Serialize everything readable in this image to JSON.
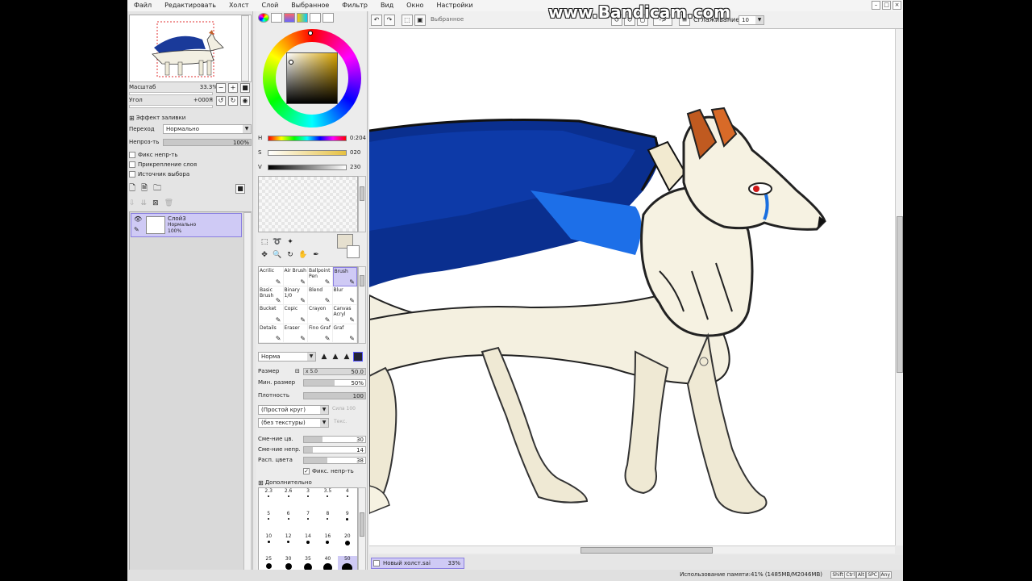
{
  "menu": [
    "Файл",
    "Редактировать",
    "Холст",
    "Слой",
    "Выбранное",
    "Фильтр",
    "Вид",
    "Окно",
    "Настройки"
  ],
  "watermark": "www.Bandicam.com",
  "navigator": {
    "zoom_label": "Масштаб",
    "zoom_value": "33.3%",
    "angle_label": "Угол",
    "angle_value": "+000Я"
  },
  "layer_panel": {
    "fill_effect": "Эффект заливки",
    "blend_label": "Переход",
    "blend_value": "Нормально",
    "opacity_label": "Непроз-ть",
    "opacity_value": "100%",
    "opacity_fraction": 1.0,
    "checkboxes": [
      "Фикс непр-ть",
      "Прикрепление слоя",
      "Источник выбора"
    ],
    "layers": [
      {
        "name": "Слой3",
        "mode": "Нормально",
        "opacity": "100%"
      }
    ]
  },
  "color": {
    "h_label": "H",
    "h_value": "0:204",
    "s_label": "S",
    "s_value": "020",
    "v_label": "V",
    "v_value": "230"
  },
  "brushes": [
    {
      "name": "Acrilic"
    },
    {
      "name": "Air Brush"
    },
    {
      "name": "Ballpoint Pen"
    },
    {
      "name": "Brush"
    },
    {
      "name": "Basic Brush"
    },
    {
      "name": "Binary 1/0"
    },
    {
      "name": "Blend"
    },
    {
      "name": "Blur"
    },
    {
      "name": "Bucket"
    },
    {
      "name": "Copic"
    },
    {
      "name": "Crayon"
    },
    {
      "name": "Canvas Acryl"
    },
    {
      "name": "Details"
    },
    {
      "name": "Eraser"
    },
    {
      "name": "Fino Graf"
    },
    {
      "name": "Graf"
    }
  ],
  "brush_props": {
    "mode": "Норма",
    "size_label": "Размер",
    "size_mult": "x 5.0",
    "size_value": "50.0",
    "min_size_label": "Мин. размер",
    "min_size_value": "50%",
    "min_size_fraction": 0.5,
    "density_label": "Плотность",
    "density_value": "100",
    "density_fraction": 1.0,
    "shape": "(Простой круг)",
    "texture": "(без текстуры)",
    "shape_strength": "Сила 100",
    "texture_strength": "Текс.",
    "blend_label": "Сме-ние цв.",
    "blend_value": "30",
    "blend_fraction": 0.3,
    "dilution_label": "Сме-ние непр.",
    "dilution_value": "14",
    "dilution_fraction": 0.14,
    "persistence_label": "Расп. цвета",
    "persistence_value": "38",
    "persistence_fraction": 0.38,
    "keep_opacity": "Фикс. непр-ть",
    "advanced": "Дополнительно"
  },
  "dot_sizes": [
    "2.3",
    "2.6",
    "3",
    "3.5",
    "4",
    "5",
    "6",
    "7",
    "8",
    "9",
    "10",
    "12",
    "14",
    "16",
    "20",
    "25",
    "30",
    "35",
    "40",
    "50"
  ],
  "canvas_toolbar": {
    "stabilizer_label": "Сглаживание",
    "stabilizer_value": "10",
    "selection_label": "Выбранное",
    "arrow": "->"
  },
  "document_tab": {
    "name": "Новый холст.sai",
    "zoom": "33%"
  },
  "status": {
    "memory": "Использование памяти:41% (1485МВ/М2046МВ)",
    "indicators": [
      "Shift",
      "Ctrl",
      "Alt",
      "SPC",
      "Any"
    ]
  }
}
